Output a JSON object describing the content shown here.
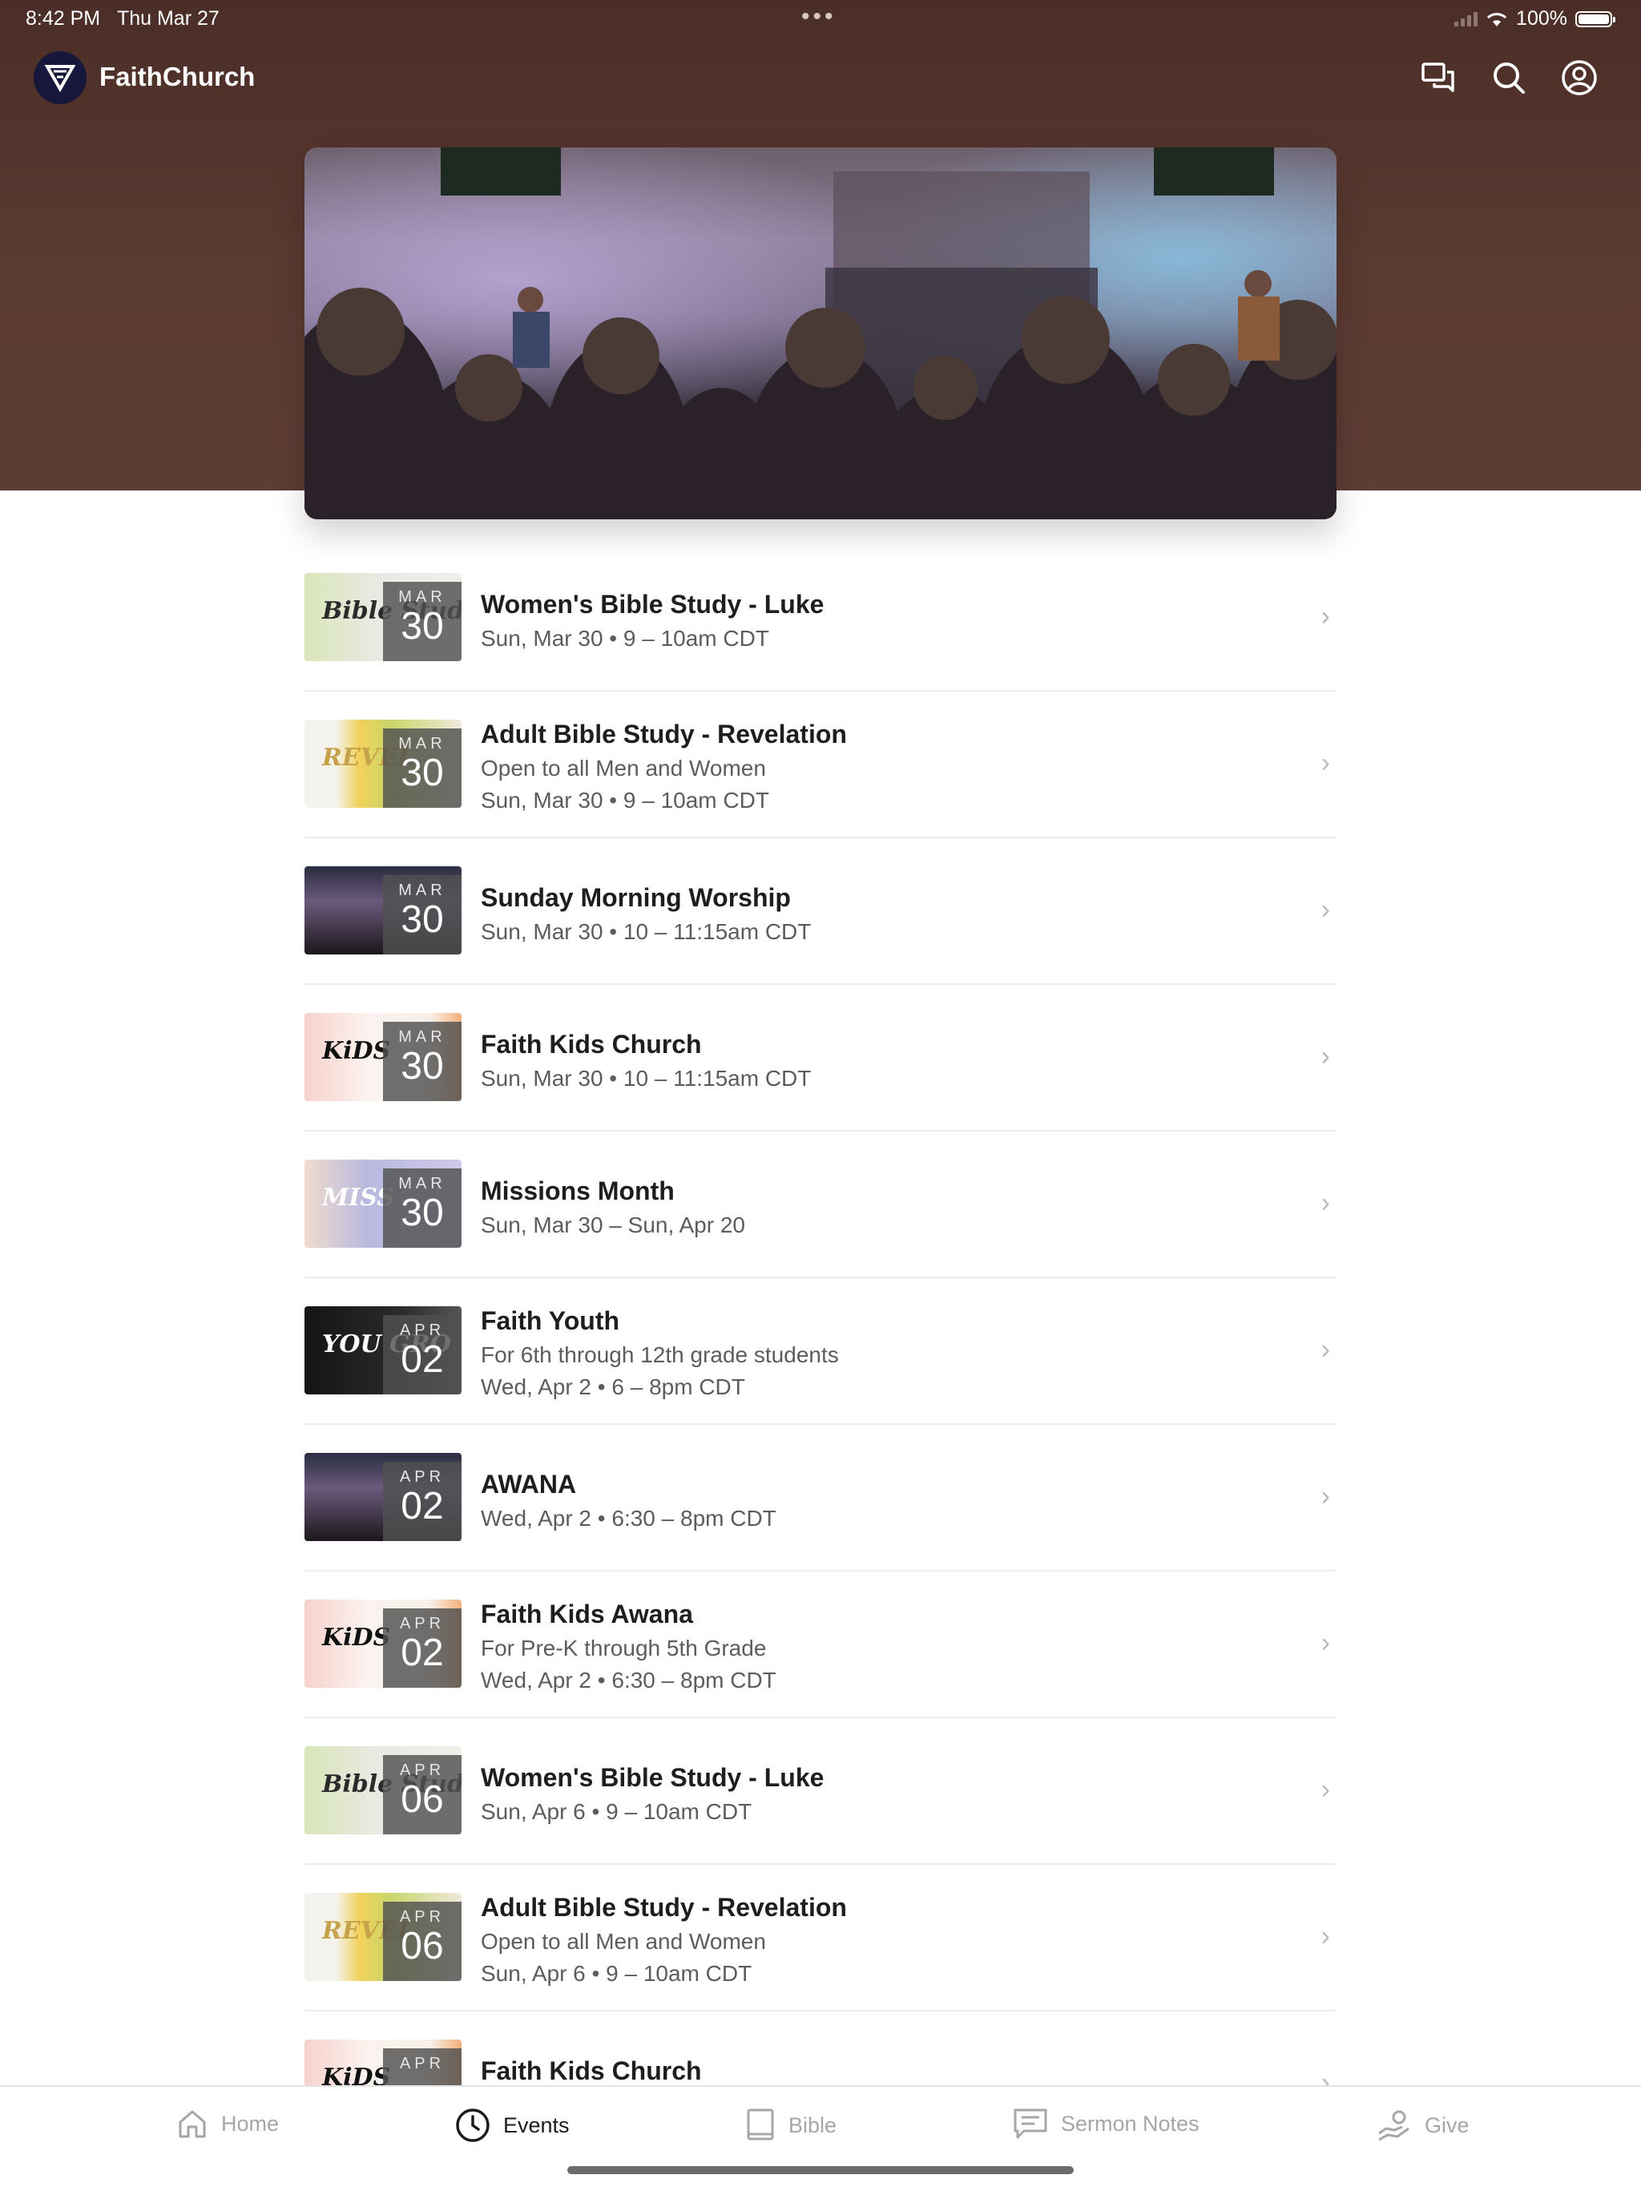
{
  "status_bar": {
    "time": "8:42 PM",
    "date": "Thu Mar 27",
    "battery": "100%"
  },
  "header": {
    "app_name": "FaithChurch",
    "icons": [
      "chat-icon",
      "search-icon",
      "profile-icon"
    ]
  },
  "hero": {
    "image": "worship service congregation photo"
  },
  "events": [
    {
      "month": "MAR",
      "day": "30",
      "title": "Women's Bible Study - Luke",
      "subtitle": "",
      "when": "Sun, Mar 30 • 9 – 10am CDT",
      "thumb": "bible-study",
      "thumb_text": "Bible Study"
    },
    {
      "month": "MAR",
      "day": "30",
      "title": "Adult Bible Study - Revelation",
      "subtitle": "Open to all Men and Women",
      "when": "Sun, Mar 30 • 9 – 10am CDT",
      "thumb": "revelation",
      "thumb_text": "REVEL"
    },
    {
      "month": "MAR",
      "day": "30",
      "title": "Sunday Morning Worship",
      "subtitle": "",
      "when": "Sun, Mar 30 • 10 – 11:15am CDT",
      "thumb": "worship",
      "thumb_text": ""
    },
    {
      "month": "MAR",
      "day": "30",
      "title": "Faith Kids Church",
      "subtitle": "",
      "when": "Sun, Mar 30 • 10 – 11:15am CDT",
      "thumb": "kids",
      "thumb_text": "KiDS"
    },
    {
      "month": "MAR",
      "day": "30",
      "title": "Missions Month",
      "subtitle": "",
      "when": "Sun, Mar 30 – Sun, Apr 20",
      "thumb": "missions",
      "thumb_text": "MISS"
    },
    {
      "month": "APR",
      "day": "02",
      "title": "Faith Youth",
      "subtitle": "For 6th through 12th grade students",
      "when": "Wed, Apr 2 • 6 – 8pm CDT",
      "thumb": "youth",
      "thumb_text": "YOU GRO"
    },
    {
      "month": "APR",
      "day": "02",
      "title": "AWANA",
      "subtitle": "",
      "when": "Wed, Apr 2 • 6:30 – 8pm CDT",
      "thumb": "worship",
      "thumb_text": ""
    },
    {
      "month": "APR",
      "day": "02",
      "title": "Faith Kids Awana",
      "subtitle": "For Pre-K through 5th Grade",
      "when": "Wed, Apr 2 • 6:30 – 8pm CDT",
      "thumb": "kids",
      "thumb_text": "KiDS"
    },
    {
      "month": "APR",
      "day": "06",
      "title": "Women's Bible Study - Luke",
      "subtitle": "",
      "when": "Sun, Apr 6 • 9 – 10am CDT",
      "thumb": "bible-study",
      "thumb_text": "Bible Study"
    },
    {
      "month": "APR",
      "day": "06",
      "title": "Adult Bible Study - Revelation",
      "subtitle": "Open to all Men and Women",
      "when": "Sun, Apr 6 • 9 – 10am CDT",
      "thumb": "revelation",
      "thumb_text": "REVEL"
    },
    {
      "month": "APR",
      "day": "",
      "title": "Faith Kids Church",
      "subtitle": "",
      "when": "",
      "thumb": "kids",
      "thumb_text": "KiDS"
    }
  ],
  "tabbar": {
    "tabs": [
      {
        "label": "Home",
        "icon": "home-icon",
        "active": false
      },
      {
        "label": "Events",
        "icon": "clock-icon",
        "active": true
      },
      {
        "label": "Bible",
        "icon": "book-icon",
        "active": false
      },
      {
        "label": "Sermon Notes",
        "icon": "notes-icon",
        "active": false
      },
      {
        "label": "Give",
        "icon": "give-icon",
        "active": false
      }
    ]
  },
  "colors": {
    "header_bg": "#4a2e27",
    "logo_bg": "#16173a",
    "active_tab": "#1c1c1c",
    "inactive_tab": "#a6a6a6"
  }
}
